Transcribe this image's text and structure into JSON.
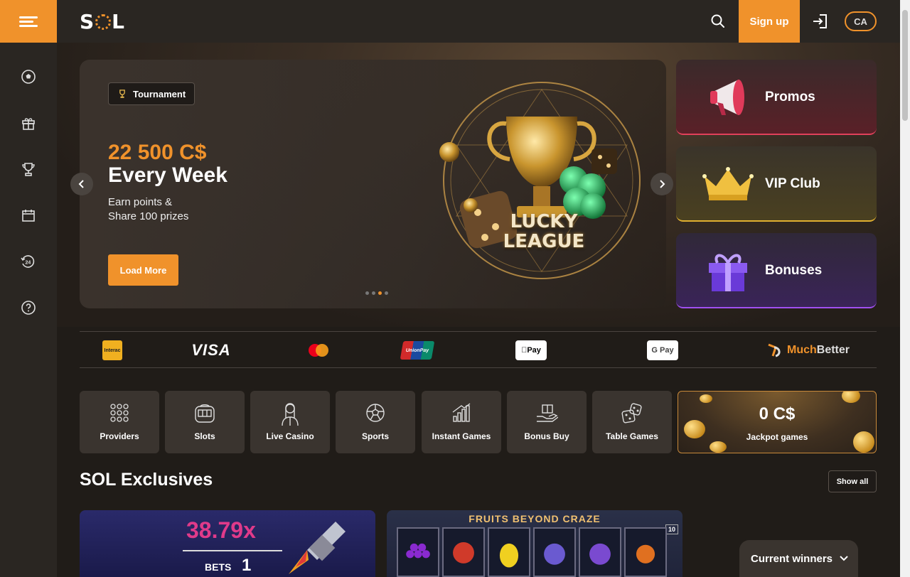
{
  "header": {
    "logo_text": "SOL",
    "signup_label": "Sign up",
    "lang_label": "CA",
    "accent": "#f0922b"
  },
  "sidebar": {
    "icons": [
      "soccer-ball-icon",
      "gift-icon",
      "trophy-icon",
      "calendar-icon",
      "support-24-icon",
      "help-icon"
    ]
  },
  "banner": {
    "badge_label": "Tournament",
    "amount": "22 500 C$",
    "headline": "Every Week",
    "sub_line1": "Earn points &",
    "sub_line2": "Share 100 prizes",
    "cta_label": "Load More",
    "art_title_line1": "LUCKY",
    "art_title_line2": "LEAGUE",
    "slide_count": 4,
    "active_slide": 3
  },
  "promo_cards": [
    {
      "label": "Promos",
      "icon": "megaphone-icon"
    },
    {
      "label": "VIP Club",
      "icon": "crown-icon"
    },
    {
      "label": "Bonuses",
      "icon": "gift-box-icon"
    }
  ],
  "payments": {
    "interac": "Interac",
    "visa": "VISA",
    "mastercard": "Mastercard",
    "unionpay": "UnionPay",
    "applepay": "Pay",
    "googlepay": "G Pay",
    "muchbetter_a": "Much",
    "muchbetter_b": "Better"
  },
  "categories": [
    {
      "label": "Providers",
      "icon": "grid-dots-icon"
    },
    {
      "label": "Slots",
      "icon": "slot-machine-icon"
    },
    {
      "label": "Live Casino",
      "icon": "dealer-icon"
    },
    {
      "label": "Sports",
      "icon": "soccer-ball-icon"
    },
    {
      "label": "Instant Games",
      "icon": "bar-chart-icon"
    },
    {
      "label": "Bonus Buy",
      "icon": "gift-hand-icon"
    },
    {
      "label": "Table Games",
      "icon": "dice-icon"
    }
  ],
  "jackpot": {
    "value": "0 C$",
    "label": "Jackpot games"
  },
  "exclusives": {
    "title": "SOL Exclusives",
    "show_all_label": "Show all",
    "games": [
      {
        "multiplier": "38.79x",
        "bets_label": "BETS",
        "bets_value": "1"
      },
      {
        "title": "FRUITS BEYOND CRAZE",
        "badge": "10"
      }
    ]
  },
  "winners_label": "Current winners"
}
